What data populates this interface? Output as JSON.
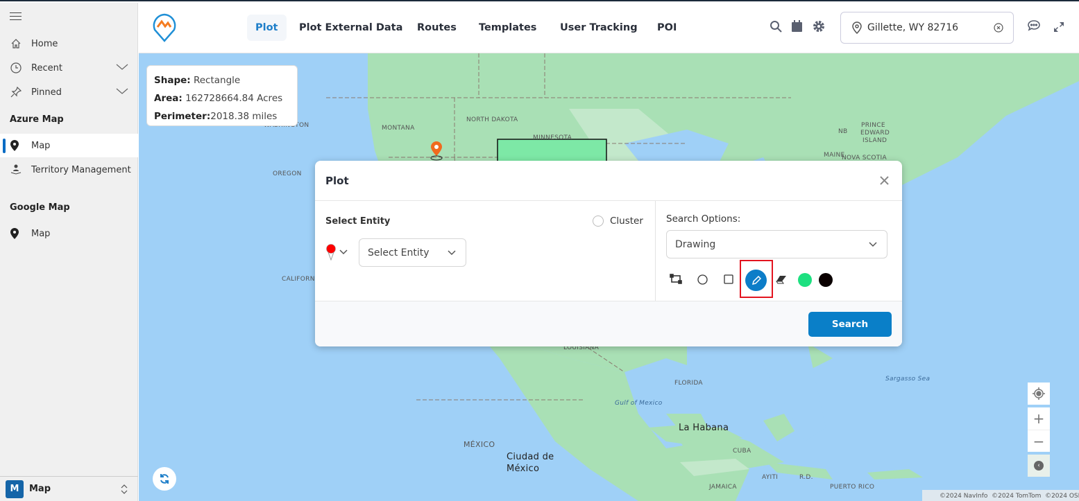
{
  "sidebar": {
    "items": [
      {
        "label": "Home",
        "icon": "home-icon"
      },
      {
        "label": "Recent",
        "icon": "clock-icon"
      },
      {
        "label": "Pinned",
        "icon": "pin-icon"
      }
    ],
    "section1": "Azure Map",
    "section1_items": [
      {
        "label": "Map",
        "active": true
      },
      {
        "label": "Territory Management"
      }
    ],
    "section2": "Google Map",
    "section2_items": [
      {
        "label": "Map"
      }
    ],
    "footer": {
      "badge": "M",
      "label": "Map"
    }
  },
  "header": {
    "tabs": [
      {
        "label": "Plot",
        "active": true
      },
      {
        "label": "Plot External Data"
      },
      {
        "label": "Routes"
      },
      {
        "label": "Templates"
      },
      {
        "label": "User Tracking"
      },
      {
        "label": "POI"
      }
    ],
    "location_value": "Gillette, WY 82716",
    "accent": "#1f7fc9"
  },
  "tooltip": {
    "shape_label": "Shape:",
    "shape": "Rectangle",
    "area_label": "Area:",
    "area": "162728664.84 Acres",
    "perimeter_label": "Perimeter:",
    "perimeter": "2018.38 miles"
  },
  "dialog": {
    "title": "Plot",
    "select_entity_label": "Select Entity",
    "cluster_label": "Cluster",
    "entity_placeholder": "Select Entity",
    "search_options_label": "Search Options:",
    "search_option_value": "Drawing",
    "colors": [
      "#1de080",
      "#0a0000"
    ],
    "search_button": "Search"
  },
  "map": {
    "labels": [
      "WASHINGTON",
      "MONTANA",
      "NORTH DAKOTA",
      "MINNESOTA",
      "OREGON",
      "CALIFORNIA",
      "NB",
      "PRINCE",
      "EDWARD",
      "ISLAND",
      "MAINE",
      "NOVA SCOTIA",
      "LOUISIANA",
      "FLORIDA",
      "Gulf of Mexico",
      "Sargasso Sea",
      "La Habana",
      "CUBA",
      "MÉXICO",
      "Ciudad de",
      "México",
      "JAMAICA",
      "AYITI",
      "R.D.",
      "PUERTO RICO"
    ],
    "attribution": "©2024 NavInfo  ©2024 TomTom  ©2024 OSM",
    "rectangle_color": "#7de8a6"
  }
}
